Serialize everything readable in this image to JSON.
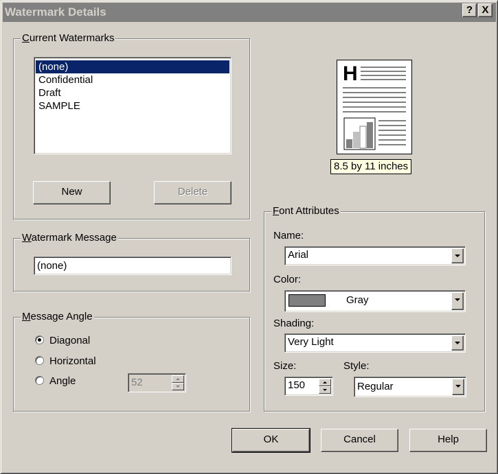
{
  "window": {
    "title": "Watermark Details",
    "help_button": "?",
    "close_button": "X"
  },
  "current_watermarks": {
    "group_label_underlined": "C",
    "group_label_rest": "urrent Watermarks",
    "items": [
      "(none)",
      "Confidential",
      "Draft",
      "SAMPLE"
    ],
    "selected_index": 0,
    "new_button": "New",
    "delete_button": "Delete"
  },
  "preview": {
    "heading_letter": "H",
    "paper_size_label": "8.5 by 11 inches"
  },
  "watermark_message": {
    "group_label_underlined": "W",
    "group_label_rest": "atermark Message",
    "value": "(none)"
  },
  "message_angle": {
    "group_label_underlined": "M",
    "group_label_rest": "essage Angle",
    "options": [
      {
        "label": "Diagonal",
        "checked": true
      },
      {
        "label": "Horizontal",
        "checked": false
      },
      {
        "label": "Angle",
        "checked": false
      }
    ],
    "angle_value": "52"
  },
  "font_attributes": {
    "group_label_underlined": "F",
    "group_label_rest": "ont Attributes",
    "name_label": "Name:",
    "name_value": "Arial",
    "color_label": "Color:",
    "color_value": "Gray",
    "color_swatch": "#808080",
    "shading_label": "Shading:",
    "shading_value": "Very Light",
    "size_label": "Size:",
    "size_value": "150",
    "style_label": "Style:",
    "style_value": "Regular"
  },
  "footer": {
    "ok": "OK",
    "cancel": "Cancel",
    "help": "Help"
  },
  "colors": {
    "dialog_bg": "#d4d0c8",
    "titlebar_inactive": "#808080",
    "selection": "#0a246a",
    "tooltip_bg": "#ffffe1"
  }
}
